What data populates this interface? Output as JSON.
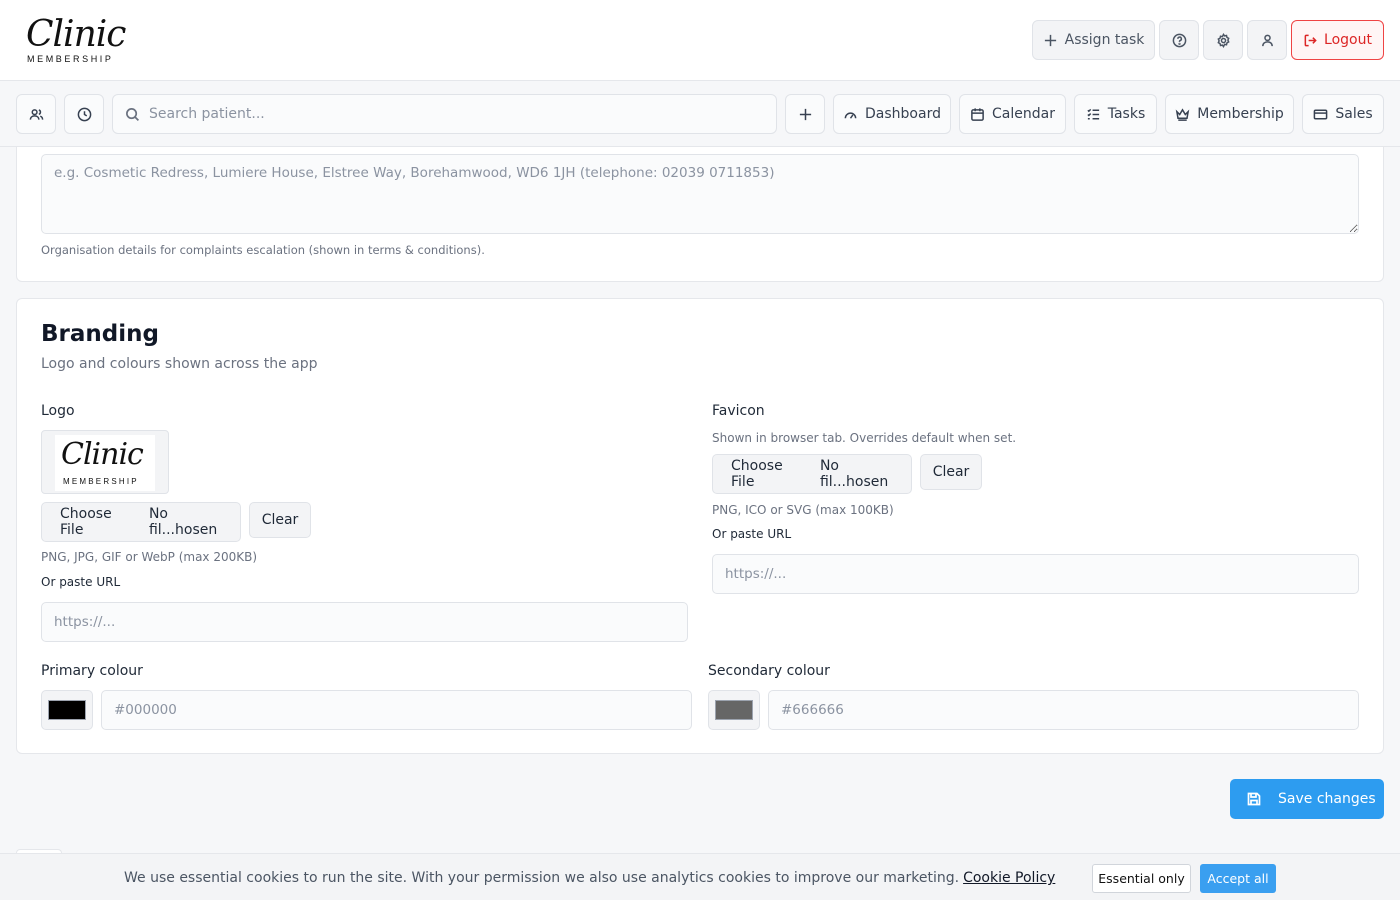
{
  "header": {
    "logo_script": "Clinic",
    "logo_sub": "MEMBERSHIP",
    "assign_task": "Assign task",
    "logout": "Logout"
  },
  "toolbar": {
    "search_placeholder": "Search patient...",
    "nav": [
      {
        "label": "Dashboard",
        "icon": "gauge-icon"
      },
      {
        "label": "Calendar",
        "icon": "calendar-icon"
      },
      {
        "label": "Tasks",
        "icon": "list-checks-icon"
      },
      {
        "label": "Membership",
        "icon": "crown-icon"
      },
      {
        "label": "Sales",
        "icon": "credit-card-icon"
      }
    ]
  },
  "complaints": {
    "placeholder": "e.g. Cosmetic Redress, Lumiere House, Elstree Way, Borehamwood, WD6 1JH (telephone: 02039 0711853)",
    "hint": "Organisation details for complaints escalation (shown in terms & conditions)."
  },
  "branding": {
    "title": "Branding",
    "subtitle": "Logo and colours shown across the app",
    "logo": {
      "label": "Logo",
      "choose_file": "Choose File",
      "no_file": "No fil...hosen",
      "clear": "Clear",
      "formats": "PNG, JPG, GIF or WebP (max 200KB)",
      "or_paste": "Or paste URL",
      "url_placeholder": "https://..."
    },
    "favicon": {
      "label": "Favicon",
      "desc": "Shown in browser tab. Overrides default when set.",
      "choose_file": "Choose File",
      "no_file": "No fil...hosen",
      "clear": "Clear",
      "formats": "PNG, ICO or SVG (max 100KB)",
      "or_paste": "Or paste URL",
      "url_placeholder": "https://..."
    },
    "primary": {
      "label": "Primary colour",
      "placeholder": "#000000",
      "color": "#000000"
    },
    "secondary": {
      "label": "Secondary colour",
      "placeholder": "#666666",
      "color": "#666666"
    }
  },
  "save_label": "Save changes",
  "cookie": {
    "message": "We use essential cookies to run the site. With your permission we also use analytics cookies to improve our marketing.",
    "policy_link": "Cookie Policy",
    "essential": "Essential only",
    "accept": "Accept all"
  },
  "colors": {
    "accent": "#2d9cf0",
    "danger": "#dc2626",
    "background": "#f6f7f9"
  }
}
